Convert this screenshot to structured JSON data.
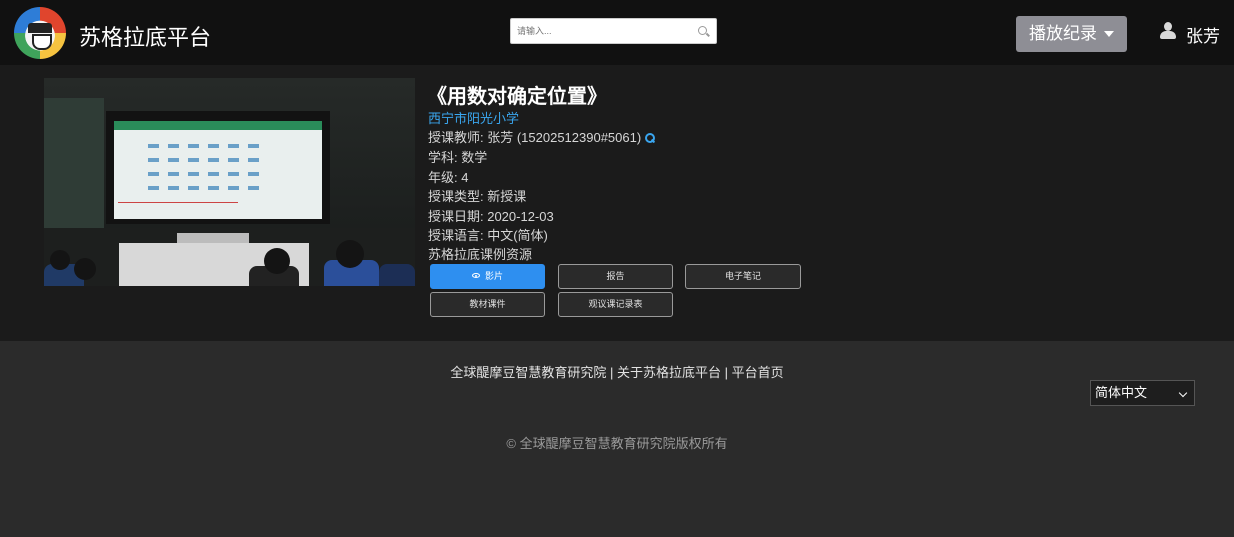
{
  "header": {
    "brand": "苏格拉底平台",
    "search_placeholder": "请输入...",
    "playback_label": "播放纪录",
    "user_name": "张芳"
  },
  "lesson": {
    "title": "《用数对确定位置》",
    "school": "西宁市阳光小学",
    "teacher": "授课教师: 张芳 (15202512390#5061)",
    "subject": "学科: 数学",
    "grade": "年级: 4",
    "lesson_type": "授课类型: 新授课",
    "date": "授课日期: 2020-12-03",
    "language": "授课语言: 中文(简体)",
    "resources_label": "苏格拉底课例资源"
  },
  "resource_buttons": {
    "video": "影片",
    "report": "报告",
    "notes": "电子笔记",
    "materials": "教材课件",
    "observation": "观议课记录表"
  },
  "footer": {
    "link_institute": "全球醍摩豆智慧教育研究院",
    "link_about": "关于苏格拉底平台",
    "link_home": "平台首页",
    "separator": "|",
    "language": "简体中文",
    "copyright": "© 全球醍摩豆智慧教育研究院版权所有"
  },
  "colors": {
    "accent": "#2e8ff0",
    "link": "#3aa6ef",
    "header_bg": "#111111",
    "content_bg": "#1b1b1b",
    "footer_bg": "#2b2b2b"
  }
}
